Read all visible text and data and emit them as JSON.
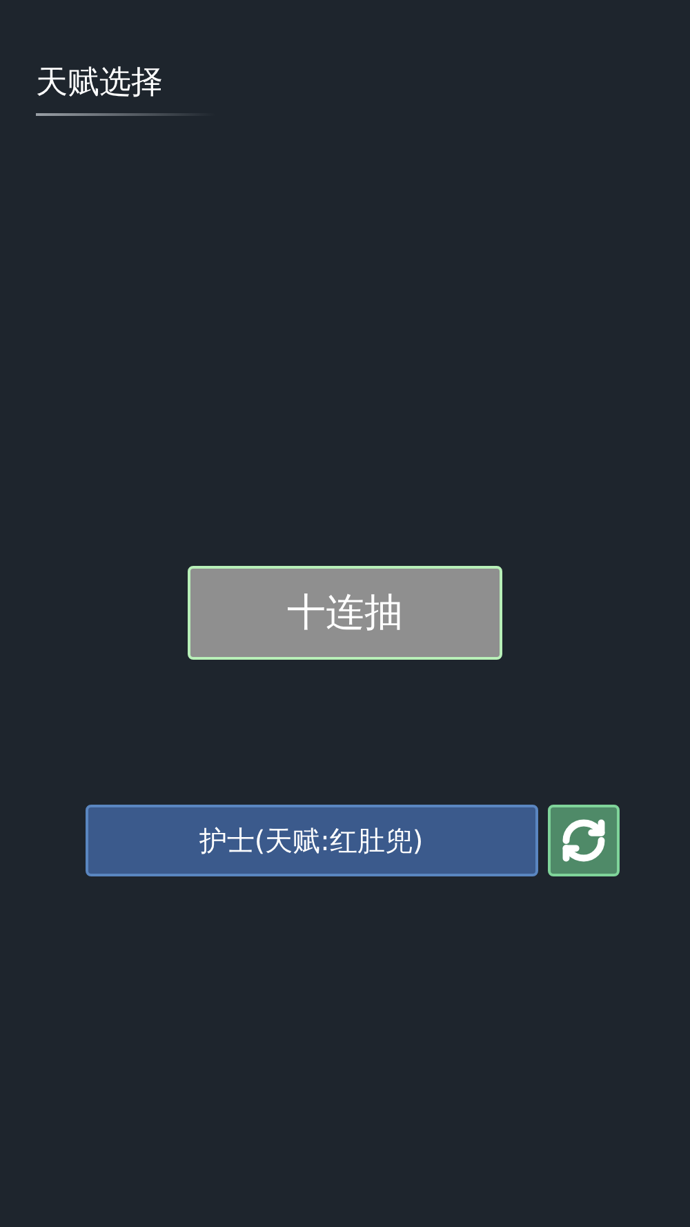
{
  "header": {
    "title": "天赋选择"
  },
  "draw_button": {
    "label": "十连抽"
  },
  "result": {
    "label": "护士(天赋:红肚兜)"
  }
}
